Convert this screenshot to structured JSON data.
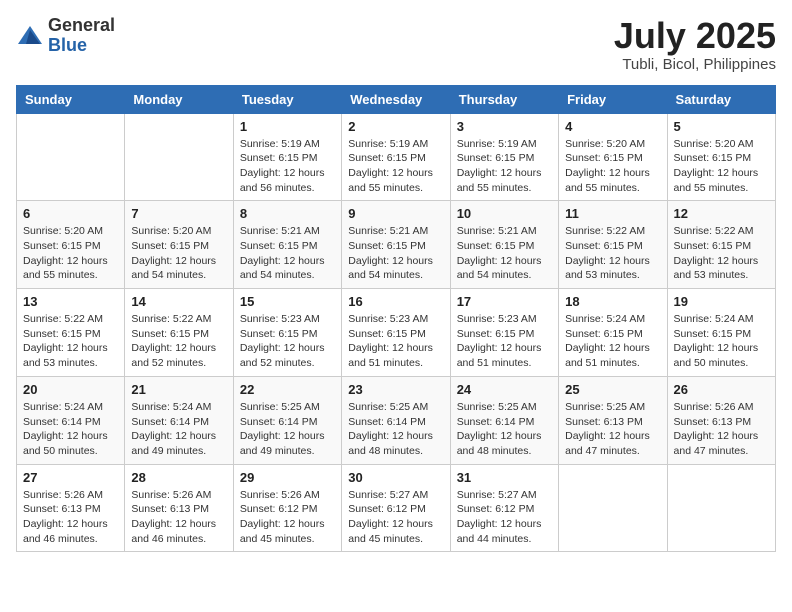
{
  "header": {
    "logo_general": "General",
    "logo_blue": "Blue",
    "month_title": "July 2025",
    "subtitle": "Tubli, Bicol, Philippines"
  },
  "weekdays": [
    "Sunday",
    "Monday",
    "Tuesday",
    "Wednesday",
    "Thursday",
    "Friday",
    "Saturday"
  ],
  "weeks": [
    [
      {
        "day": "",
        "info": ""
      },
      {
        "day": "",
        "info": ""
      },
      {
        "day": "1",
        "info": "Sunrise: 5:19 AM\nSunset: 6:15 PM\nDaylight: 12 hours and 56 minutes."
      },
      {
        "day": "2",
        "info": "Sunrise: 5:19 AM\nSunset: 6:15 PM\nDaylight: 12 hours and 55 minutes."
      },
      {
        "day": "3",
        "info": "Sunrise: 5:19 AM\nSunset: 6:15 PM\nDaylight: 12 hours and 55 minutes."
      },
      {
        "day": "4",
        "info": "Sunrise: 5:20 AM\nSunset: 6:15 PM\nDaylight: 12 hours and 55 minutes."
      },
      {
        "day": "5",
        "info": "Sunrise: 5:20 AM\nSunset: 6:15 PM\nDaylight: 12 hours and 55 minutes."
      }
    ],
    [
      {
        "day": "6",
        "info": "Sunrise: 5:20 AM\nSunset: 6:15 PM\nDaylight: 12 hours and 55 minutes."
      },
      {
        "day": "7",
        "info": "Sunrise: 5:20 AM\nSunset: 6:15 PM\nDaylight: 12 hours and 54 minutes."
      },
      {
        "day": "8",
        "info": "Sunrise: 5:21 AM\nSunset: 6:15 PM\nDaylight: 12 hours and 54 minutes."
      },
      {
        "day": "9",
        "info": "Sunrise: 5:21 AM\nSunset: 6:15 PM\nDaylight: 12 hours and 54 minutes."
      },
      {
        "day": "10",
        "info": "Sunrise: 5:21 AM\nSunset: 6:15 PM\nDaylight: 12 hours and 54 minutes."
      },
      {
        "day": "11",
        "info": "Sunrise: 5:22 AM\nSunset: 6:15 PM\nDaylight: 12 hours and 53 minutes."
      },
      {
        "day": "12",
        "info": "Sunrise: 5:22 AM\nSunset: 6:15 PM\nDaylight: 12 hours and 53 minutes."
      }
    ],
    [
      {
        "day": "13",
        "info": "Sunrise: 5:22 AM\nSunset: 6:15 PM\nDaylight: 12 hours and 53 minutes."
      },
      {
        "day": "14",
        "info": "Sunrise: 5:22 AM\nSunset: 6:15 PM\nDaylight: 12 hours and 52 minutes."
      },
      {
        "day": "15",
        "info": "Sunrise: 5:23 AM\nSunset: 6:15 PM\nDaylight: 12 hours and 52 minutes."
      },
      {
        "day": "16",
        "info": "Sunrise: 5:23 AM\nSunset: 6:15 PM\nDaylight: 12 hours and 51 minutes."
      },
      {
        "day": "17",
        "info": "Sunrise: 5:23 AM\nSunset: 6:15 PM\nDaylight: 12 hours and 51 minutes."
      },
      {
        "day": "18",
        "info": "Sunrise: 5:24 AM\nSunset: 6:15 PM\nDaylight: 12 hours and 51 minutes."
      },
      {
        "day": "19",
        "info": "Sunrise: 5:24 AM\nSunset: 6:15 PM\nDaylight: 12 hours and 50 minutes."
      }
    ],
    [
      {
        "day": "20",
        "info": "Sunrise: 5:24 AM\nSunset: 6:14 PM\nDaylight: 12 hours and 50 minutes."
      },
      {
        "day": "21",
        "info": "Sunrise: 5:24 AM\nSunset: 6:14 PM\nDaylight: 12 hours and 49 minutes."
      },
      {
        "day": "22",
        "info": "Sunrise: 5:25 AM\nSunset: 6:14 PM\nDaylight: 12 hours and 49 minutes."
      },
      {
        "day": "23",
        "info": "Sunrise: 5:25 AM\nSunset: 6:14 PM\nDaylight: 12 hours and 48 minutes."
      },
      {
        "day": "24",
        "info": "Sunrise: 5:25 AM\nSunset: 6:14 PM\nDaylight: 12 hours and 48 minutes."
      },
      {
        "day": "25",
        "info": "Sunrise: 5:25 AM\nSunset: 6:13 PM\nDaylight: 12 hours and 47 minutes."
      },
      {
        "day": "26",
        "info": "Sunrise: 5:26 AM\nSunset: 6:13 PM\nDaylight: 12 hours and 47 minutes."
      }
    ],
    [
      {
        "day": "27",
        "info": "Sunrise: 5:26 AM\nSunset: 6:13 PM\nDaylight: 12 hours and 46 minutes."
      },
      {
        "day": "28",
        "info": "Sunrise: 5:26 AM\nSunset: 6:13 PM\nDaylight: 12 hours and 46 minutes."
      },
      {
        "day": "29",
        "info": "Sunrise: 5:26 AM\nSunset: 6:12 PM\nDaylight: 12 hours and 45 minutes."
      },
      {
        "day": "30",
        "info": "Sunrise: 5:27 AM\nSunset: 6:12 PM\nDaylight: 12 hours and 45 minutes."
      },
      {
        "day": "31",
        "info": "Sunrise: 5:27 AM\nSunset: 6:12 PM\nDaylight: 12 hours and 44 minutes."
      },
      {
        "day": "",
        "info": ""
      },
      {
        "day": "",
        "info": ""
      }
    ]
  ]
}
